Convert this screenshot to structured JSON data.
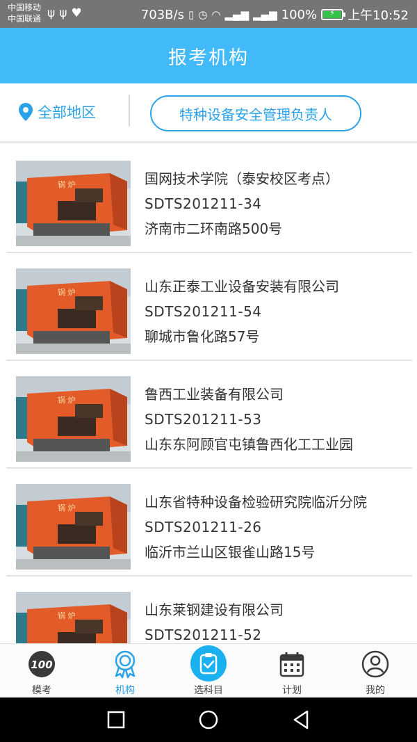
{
  "status_bar": {
    "carrier1": "中国移动",
    "carrier2": "中国联通",
    "net_speed": "703B/s",
    "battery": "100%",
    "time": "上午10:52"
  },
  "header": {
    "title": "报考机构"
  },
  "filters": {
    "region_label": "全部地区",
    "category_label": "特种设备安全管理负责人"
  },
  "items": [
    {
      "name": "国网技术学院（泰安校区考点）",
      "code": "SDTS201211-34",
      "address": "济南市二环南路500号"
    },
    {
      "name": "山东正泰工业设备安装有限公司",
      "code": "SDTS201211-54",
      "address": "聊城市鲁化路57号"
    },
    {
      "name": "鲁西工业装备有限公司",
      "code": "SDTS201211-53",
      "address": "山东东阿顾官屯镇鲁西化工工业园"
    },
    {
      "name": "山东省特种设备检验研究院临沂分院",
      "code": "SDTS201211-26",
      "address": "临沂市兰山区银雀山路15号"
    },
    {
      "name": "山东莱钢建设有限公司",
      "code": "SDTS201211-52",
      "address": ""
    }
  ],
  "tabs": [
    {
      "label": "模考",
      "icon": "score-100-icon"
    },
    {
      "label": "机构",
      "icon": "institution-badge-icon"
    },
    {
      "label": "选科目",
      "icon": "select-subject-icon"
    },
    {
      "label": "计划",
      "icon": "calendar-icon"
    },
    {
      "label": "我的",
      "icon": "user-profile-icon"
    }
  ],
  "colors": {
    "primary": "#42b9f8",
    "accent": "#2aa2ea",
    "boiler": "#e25b28"
  }
}
